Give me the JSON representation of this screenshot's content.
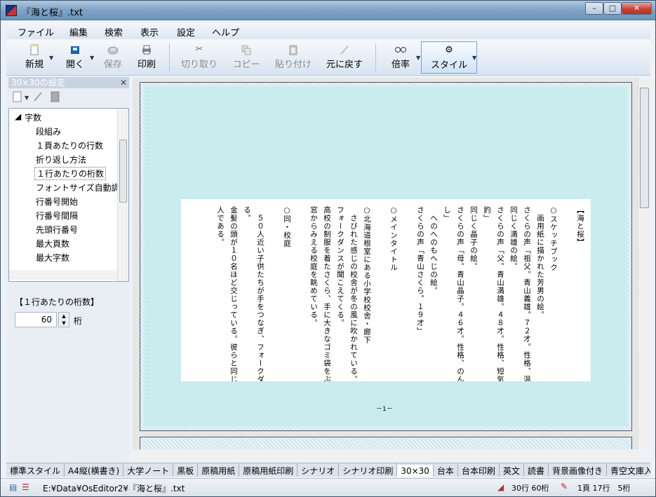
{
  "window": {
    "title": "『海と桜』.txt",
    "min": "–",
    "max": "□",
    "close": "✕"
  },
  "menu": [
    "ファイル",
    "編集",
    "検索",
    "表示",
    "設定",
    "ヘルプ"
  ],
  "toolbar": {
    "new": {
      "label": "新規",
      "icon": "new-document-icon"
    },
    "open": {
      "label": "開く",
      "icon": "open-icon"
    },
    "save": {
      "label": "保存",
      "icon": "save-disk-icon"
    },
    "print": {
      "label": "印刷",
      "icon": "printer-icon"
    },
    "cut": {
      "label": "切り取り",
      "icon": "scissors-icon"
    },
    "copy": {
      "label": "コピー",
      "icon": "copy-icon"
    },
    "paste": {
      "label": "貼り付け",
      "icon": "paste-icon"
    },
    "undo": {
      "label": "元に戻す",
      "icon": "undo-icon"
    },
    "zoom": {
      "label": "倍率",
      "icon": "glasses-icon"
    },
    "style": {
      "label": "スタイル",
      "icon": "gear-icon"
    }
  },
  "left_pane": {
    "title": "30×30の設定",
    "tree": {
      "root": "字数",
      "items": [
        "段組み",
        "１頁あたりの行数",
        "折り返し方法",
        "１行あたりの桁数",
        "フォントサイズ自動調",
        "行番号開始",
        "行番号間隔",
        "先頭行番号",
        "最大頁数",
        "最大字数"
      ],
      "selected_index": 3
    },
    "property_label": "【１行あたりの桁数】",
    "value": "60",
    "unit": "桁"
  },
  "document": {
    "columns": [
      "【海と桜】",
      "",
      "○スケッチブック",
      "　画用紙に描かれた芳男の絵。",
      "さくらの声「祖父。青山義雄。７２才。性格、温和。趣",
      "同じく満雄の絵。",
      "さくらの声「父。青山満雄。４８才。性格、短気。趣味",
      "釣」",
      "同じく晶子の絵。",
      "さくらの声「母。青山晶子。４６才。性格、のんき。趣",
      "し」",
      "　へのへのもへじの絵。",
      "さくらの声「青山さくら。１９才」",
      "",
      "○メインタイトル",
      "",
      "○北海道根室にある小学校校舎・廊下",
      "　さびれた感じの校舎が冬の風に吹かれている。",
      "フォークダンスが聞こえてくる。",
      "高校の制服を着たさくら、手に大きなゴミ袋をぶら",
      "窓からみえる校庭を眺めている。",
      "",
      "○同・校庭",
      "",
      "　５０人近い子供たちが手をつなぎ、フォークダンス",
      "る。",
      "金髪の頭が１０名ほど交じっている。彼らと同じ年",
      "人である。"
    ],
    "page_number": "－1－"
  },
  "tabs": [
    "標準スタイル",
    "A4縦(横書き)",
    "大学ノート",
    "黒板",
    "原稿用紙",
    "原稿用紙印刷",
    "シナリオ",
    "シナリオ印刷",
    "30×30",
    "台本",
    "台本印刷",
    "英文",
    "読書",
    "背景画像付き",
    "青空文庫入力校正"
  ],
  "active_tab": "30×30",
  "status": {
    "path": "E:¥Data¥OsEditor2¥『海と桜』.txt",
    "layout_info": "30行 60桁",
    "cursor_info": "1頁 17行　5桁"
  }
}
